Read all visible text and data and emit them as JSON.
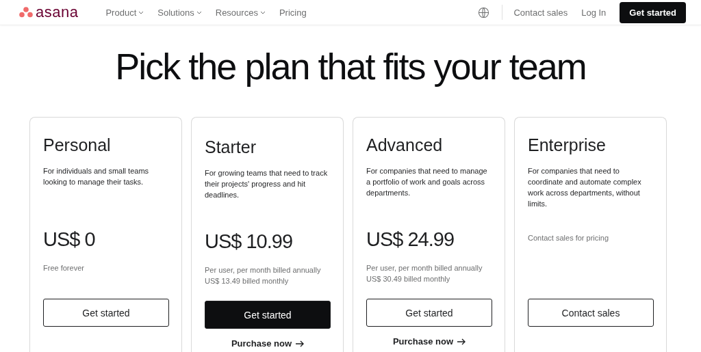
{
  "nav": {
    "logo": "asana",
    "menu": [
      {
        "label": "Product",
        "dropdown": true
      },
      {
        "label": "Solutions",
        "dropdown": true
      },
      {
        "label": "Resources",
        "dropdown": true
      },
      {
        "label": "Pricing",
        "dropdown": false
      }
    ],
    "contact": "Contact sales",
    "login": "Log In",
    "cta": "Get started"
  },
  "headline": "Pick the plan that fits your team",
  "plans": [
    {
      "name": "Personal",
      "description": "For individuals and small teams looking to manage their tasks.",
      "price": "US$ 0",
      "notes": [
        "Free forever"
      ],
      "button": {
        "label": "Get started",
        "kind": "outline"
      }
    },
    {
      "name": "Starter",
      "description": "For growing teams that need to track their projects' progress and hit deadlines.",
      "price": "US$ 10.99",
      "notes": [
        "Per user, per month billed annually",
        "US$ 13.49 billed monthly"
      ],
      "button": {
        "label": "Get started",
        "kind": "filled"
      },
      "link": "Purchase now"
    },
    {
      "name": "Advanced",
      "description": "For companies that need to manage a portfolio of work and goals across departments.",
      "price": "US$ 24.99",
      "notes": [
        "Per user, per month billed annually",
        "US$ 30.49 billed monthly"
      ],
      "button": {
        "label": "Get started",
        "kind": "outline"
      },
      "link": "Purchase now"
    },
    {
      "name": "Enterprise",
      "description": "For companies that need to coordinate and automate complex work across departments, without limits.",
      "notes": [
        "Contact sales for pricing"
      ],
      "button": {
        "label": "Contact sales",
        "kind": "outline"
      }
    }
  ]
}
